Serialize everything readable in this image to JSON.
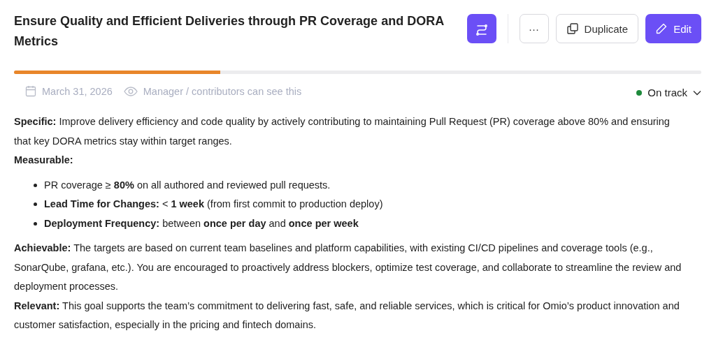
{
  "title": "Ensure Quality and Efficient Deliveries through PR Coverage and DORA Metrics",
  "buttons": {
    "more": "···",
    "duplicate": "Duplicate",
    "edit": "Edit"
  },
  "progress": {
    "level": 0.3
  },
  "meta": {
    "date": "March 31, 2026",
    "visibility": "Manager / contributors can see this"
  },
  "status": {
    "label": "On track",
    "color": "#1e8a3c"
  },
  "blocks": [
    {
      "kind": "paragraph",
      "text": "**Specific:** Improve delivery efficiency and code quality by actively contributing to maintaining Pull Request (PR) coverage above 80% and ensuring that key DORA metrics stay within target ranges."
    },
    {
      "kind": "paragraph",
      "text": "**Measurable:**"
    },
    {
      "kind": "bullets",
      "items": [
        "PR coverage ≥ **80%** on all authored and reviewed pull requests.",
        "**Lead Time for Changes:** < **1 week** (from first commit to production deploy)",
        "**Deployment Frequency:** between **once per day** and **once per week**"
      ]
    },
    {
      "kind": "paragraph",
      "text": "**Achievable:** The targets are based on current team baselines and platform capabilities, with existing CI/CD pipelines and coverage tools (e.g., SonarQube, grafana, etc.). You are encouraged to proactively address blockers, optimize test coverage, and collaborate to streamline the review and deployment processes."
    },
    {
      "kind": "paragraph",
      "text": "**Relevant:** This goal supports the team’s commitment to delivering fast, safe, and reliable services, which is critical for Omio’s product innovation and customer satisfaction, especially in the pricing and fintech domains."
    }
  ]
}
